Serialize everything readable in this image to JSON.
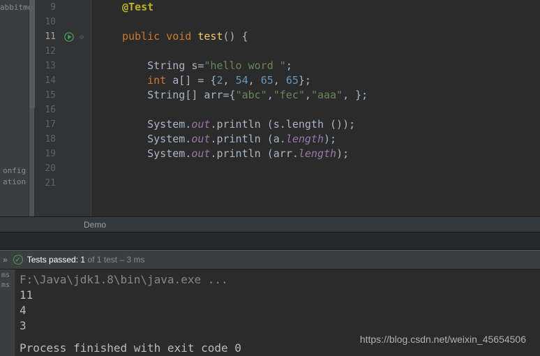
{
  "sidebar": {
    "label_top": "abbitmq",
    "label_mid1": "onfig",
    "label_mid2": "ation"
  },
  "gutter": {
    "lines": [
      "9",
      "10",
      "11",
      "12",
      "13",
      "14",
      "15",
      "16",
      "17",
      "18",
      "19",
      "20",
      "21"
    ]
  },
  "code": {
    "l9_annotation": "@Test",
    "l11_kw1": "public",
    "l11_kw2": "void",
    "l11_fn": "test",
    "l11_paren": "()",
    "l11_brace": "{",
    "l13_type": "String",
    "l13_var": " s=",
    "l13_str": "\"hello word \"",
    "l13_end": ";",
    "l14_kw": "int",
    "l14_var": " a[] = {",
    "l14_n1": "2",
    "l14_n2": "54",
    "l14_n3": "65",
    "l14_n4": "65",
    "l14_sep": ", ",
    "l14_end": "};",
    "l15_type": "String",
    "l15_var": "[] arr={",
    "l15_s1": "\"abc\"",
    "l15_s2": "\"fec\"",
    "l15_s3": "\"aaa\"",
    "l15_comma": ",",
    "l15_end": ", };",
    "l17_pre": "System.",
    "l17_out": "out",
    "l17_post": ".println (s.length ());",
    "l18_pre": "System.",
    "l18_out": "out",
    "l18_post": ".println (a.",
    "l18_len": "length",
    "l18_end": ");",
    "l19_pre": "System.",
    "l19_out": "out",
    "l19_post": ".println (arr.",
    "l19_len": "length",
    "l19_end": ");"
  },
  "breadcrumb": "Demo",
  "tests": {
    "prefix": "Tests passed:",
    "count": "1",
    "of": "of 1 test",
    "time": "– 3 ms"
  },
  "console_left": {
    "l1": "ms",
    "l2": "ms"
  },
  "console": {
    "cmd": "F:\\Java\\jdk1.8\\bin\\java.exe ...",
    "o1": "11",
    "o2": "4",
    "o3": "3",
    "exit": "Process finished with exit code 0"
  },
  "watermark": "https://blog.csdn.net/weixin_45654506"
}
